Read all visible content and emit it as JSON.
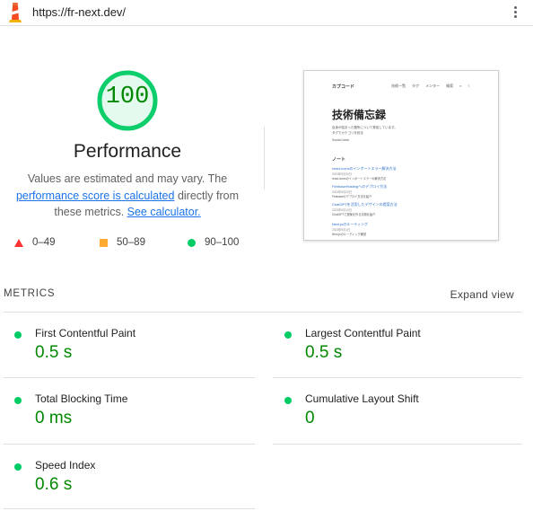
{
  "url_bar": {
    "url": "https://fr-next.dev/",
    "logo_icon": "lighthouse-icon",
    "menu_icon": "more-vert-icon"
  },
  "gauge": {
    "score": "100",
    "score_value": 100,
    "title": "Performance",
    "color": "#0cce6b"
  },
  "summary": {
    "text_before": "Values are estimated and may vary. The ",
    "link1": "performance score is calculated",
    "text_middle": " directly from these metrics. ",
    "link2": "See calculator."
  },
  "legend": [
    {
      "range": "0–49",
      "icon": "red-triangle-icon",
      "color": "#ff3333"
    },
    {
      "range": "50–89",
      "icon": "orange-square-icon",
      "color": "#ffaa33"
    },
    {
      "range": "90–100",
      "icon": "green-circle-icon",
      "color": "#00cc66"
    }
  ],
  "thumbnail": {
    "site_name": "カブコード",
    "nav_links": [
      "技術一覧",
      "タグ",
      "メンター",
      "検索"
    ],
    "heading": "技術備忘録",
    "intro_1": "自身が詰まった箇所について発信しています。",
    "intro_2": "タグでカテゴリを絞る",
    "social": "Social Links:",
    "section": "ノート",
    "items": [
      {
        "title": "react-iconsのインポートエラー解決方法",
        "date": "2023年9月30日",
        "desc": "react-iconsのインポートエラーの解決方法"
      },
      {
        "title": "FirebaseHostingへのデプロイ方法",
        "date": "2023年9月20日",
        "desc": "Firebaseのデプロイ方法を紹介"
      },
      {
        "title": "ChatGPTを活用したデザインの提案方法",
        "date": "2023年9月10日",
        "desc": "ChatGPTで提案を作る手順を紹介"
      },
      {
        "title": "Next.jsのルーティング",
        "date": "2023年9月1日",
        "desc": "Next.jsのルーティング解説"
      }
    ]
  },
  "metrics": {
    "heading": "METRICS",
    "expand_label": "Expand view",
    "items": [
      {
        "name": "First Contentful Paint",
        "value": "0.5 s",
        "status": "pass"
      },
      {
        "name": "Largest Contentful Paint",
        "value": "0.5 s",
        "status": "pass"
      },
      {
        "name": "Total Blocking Time",
        "value": "0 ms",
        "status": "pass"
      },
      {
        "name": "Cumulative Layout Shift",
        "value": "0",
        "status": "pass"
      },
      {
        "name": "Speed Index",
        "value": "0.6 s",
        "status": "pass"
      }
    ]
  }
}
